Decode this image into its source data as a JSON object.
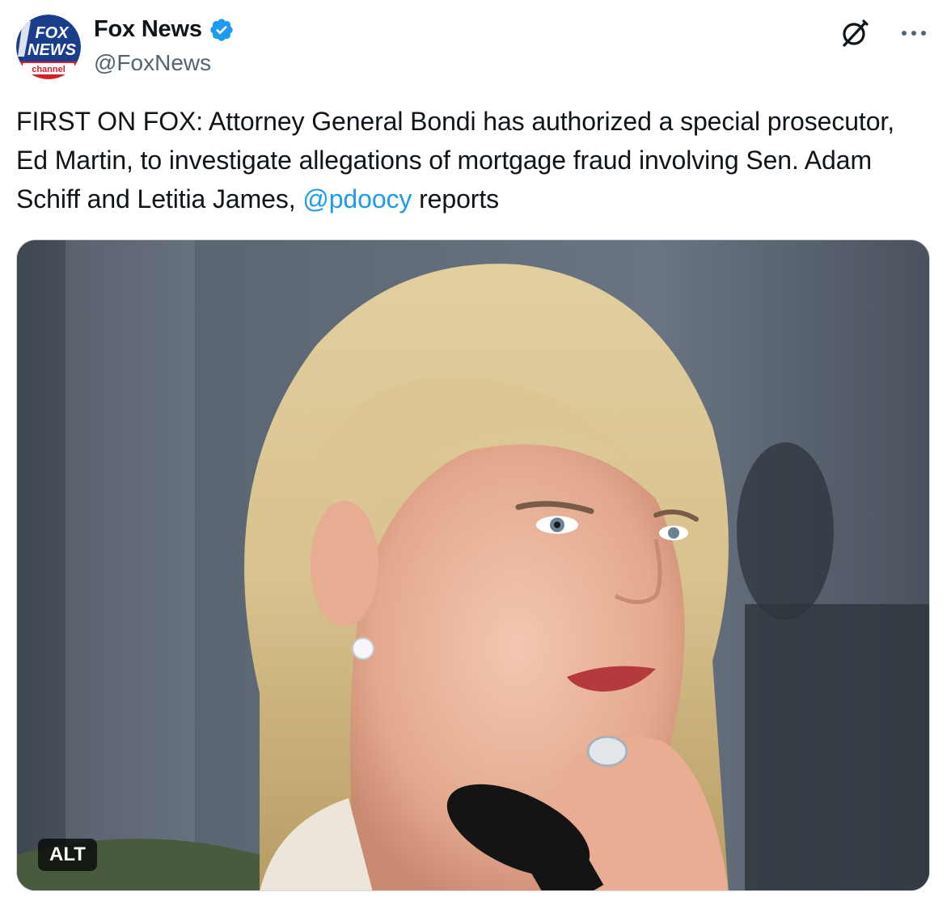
{
  "author": {
    "display_name": "Fox News",
    "handle": "@FoxNews",
    "verified": true,
    "avatar_lines": [
      "FOX",
      "NEWS",
      "channel"
    ]
  },
  "tweet": {
    "text_before_mention": "FIRST ON FOX: Attorney General Bondi has authorized a special prosecutor, Ed Martin, to investigate allegations of mortgage fraud involving Sen. Adam Schiff and Letitia James, ",
    "mention": "@pdoocy",
    "text_after_mention": " reports"
  },
  "media": {
    "alt_badge": "ALT"
  },
  "icons": {
    "verified": "verified-badge-icon",
    "grok": "grok-icon",
    "more": "more-options-icon"
  },
  "colors": {
    "text": "#0f1419",
    "secondary": "#536471",
    "link": "#1d9bf0",
    "verified": "#1d9bf0",
    "fox_red": "#d4202a",
    "fox_blue": "#1a3e8c"
  }
}
